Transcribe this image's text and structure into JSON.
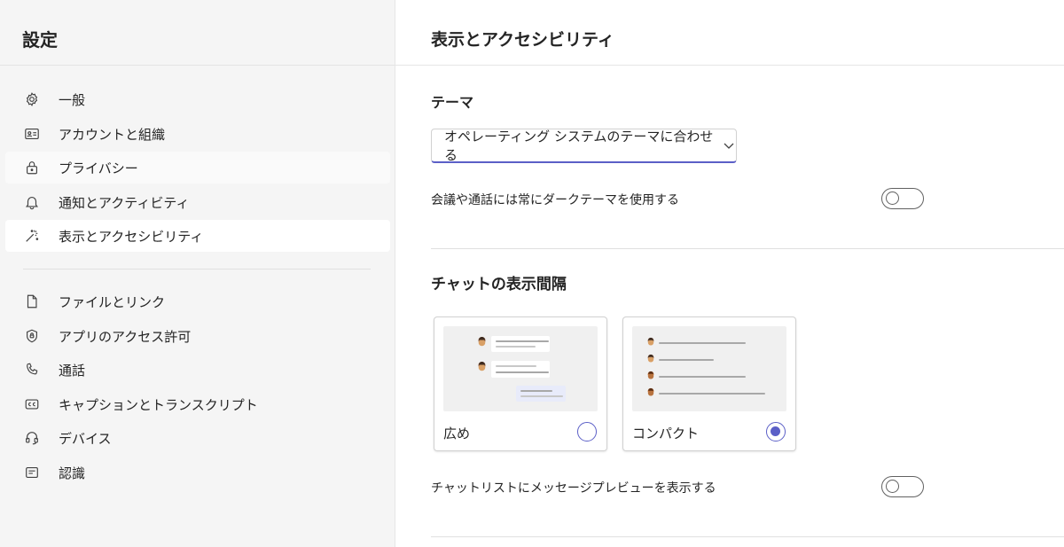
{
  "sidebar": {
    "title": "設定",
    "items": [
      {
        "label": "一般",
        "icon": "gear-icon"
      },
      {
        "label": "アカウントと組織",
        "icon": "contact-card-icon"
      },
      {
        "label": "プライバシー",
        "icon": "lock-icon"
      },
      {
        "label": "通知とアクティビティ",
        "icon": "bell-icon"
      },
      {
        "label": "表示とアクセシビリティ",
        "icon": "magic-wand-icon"
      },
      {
        "label": "ファイルとリンク",
        "icon": "document-icon"
      },
      {
        "label": "アプリのアクセス許可",
        "icon": "shield-icon"
      },
      {
        "label": "通話",
        "icon": "phone-icon"
      },
      {
        "label": "キャプションとトランスクリプト",
        "icon": "closed-caption-icon"
      },
      {
        "label": "デバイス",
        "icon": "headset-icon"
      },
      {
        "label": "認識",
        "icon": "text-box-icon"
      }
    ],
    "selected_index": 4
  },
  "main": {
    "title": "表示とアクセシビリティ",
    "theme": {
      "heading": "テーマ",
      "dropdown_value": "オペレーティング システムのテーマに合わせる",
      "dark_meetings_label": "会議や通話には常にダークテーマを使用する",
      "dark_meetings_on": false
    },
    "chat_density": {
      "heading": "チャットの表示間隔",
      "options": [
        {
          "label": "広め",
          "selected": false
        },
        {
          "label": "コンパクト",
          "selected": true
        }
      ],
      "preview_label": "チャットリストにメッセージプレビューを表示する",
      "preview_on": false
    }
  },
  "colors": {
    "accent": "#5b5fc7",
    "sidebar_bg": "#f5f5f5"
  }
}
